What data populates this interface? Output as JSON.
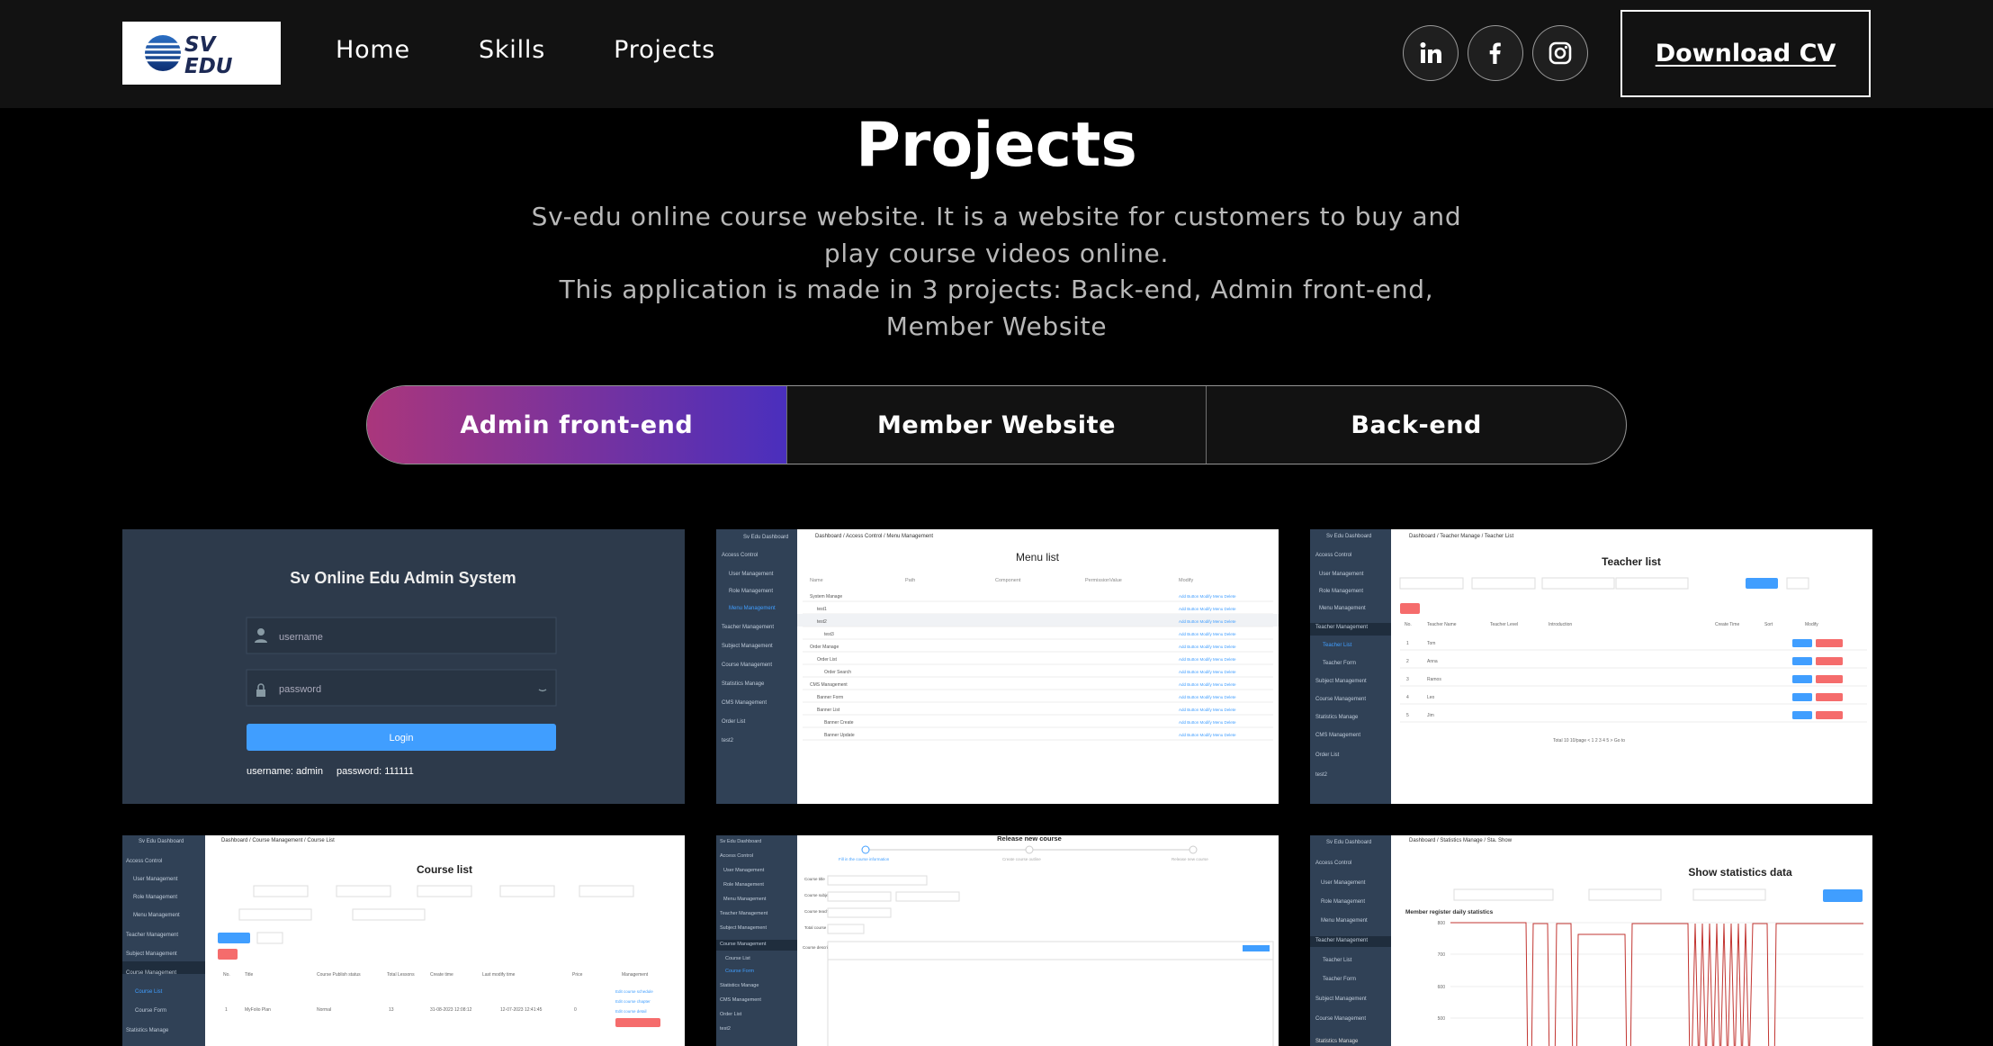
{
  "nav": {
    "logo_text": "SV EDU",
    "links": [
      "Home",
      "Skills",
      "Projects"
    ],
    "social_icons": [
      "linkedin-icon",
      "facebook-icon",
      "instagram-icon"
    ],
    "download_cv": "Download CV"
  },
  "projects": {
    "title": "Projects",
    "description_line1": "Sv-edu online course website. It is a website for customers to buy and play course videos online.",
    "description_line2": "This application is made in 3 projects: Back-end, Admin front-end, Member Website",
    "tabs": [
      "Admin front-end",
      "Member Website",
      "Back-end"
    ],
    "active_tab": "Admin front-end"
  },
  "gallery": {
    "login": {
      "title": "Sv Online Edu Admin System",
      "username_placeholder": "username",
      "password_placeholder": "password",
      "login_button": "Login",
      "hint_user": "username: admin",
      "hint_pass": "password: 111111"
    },
    "menu_list": {
      "title": "Menu list",
      "columns": [
        "Name",
        "Path",
        "Component",
        "PermissionValue",
        "Modify"
      ],
      "rows": [
        "System Manage",
        "test1",
        "test2",
        "test3",
        "Order Manage",
        "Order List",
        "Order Search",
        "CMS Management",
        "Banner Form",
        "Banner List",
        "Banner Create",
        "Banner Update"
      ]
    },
    "teacher_list": {
      "title": "Teacher list",
      "columns": [
        "No.",
        "Teacher Name",
        "Teacher Level",
        "Introduction",
        "Create Time",
        "Sort",
        "Modify"
      ],
      "rows": [
        "Tom",
        "Anna",
        "Ramos",
        "Leo",
        "Jim"
      ]
    },
    "course_list": {
      "title": "Course list",
      "columns": [
        "No.",
        "Title",
        "Course Publish status",
        "Total Lessons",
        "Create time",
        "Last modify time",
        "Price",
        "Management"
      ],
      "row_title": "MyFolio Plan",
      "row_status": "Normal"
    },
    "release_course": {
      "title": "Release new course",
      "steps": [
        "Fill in the course information",
        "Create course outline",
        "Release new course"
      ]
    },
    "statistics": {
      "title": "Show statistics data",
      "subtitle": "Member register daily statistics",
      "y_ticks": [
        "800",
        "700",
        "600",
        "500",
        "400"
      ]
    },
    "sidebar_items": [
      "Sv Edu Dashboard",
      "Access Control",
      "User Management",
      "Role Management",
      "Menu Management",
      "Teacher Management",
      "Subject Management",
      "Course Management",
      "Statistics Manage",
      "CMS Management",
      "Order List",
      "test2"
    ]
  },
  "colors": {
    "tab_gradient_start": "#aa367c",
    "tab_gradient_end": "#4a2fbd",
    "admin_sidebar": "#304156",
    "admin_primary": "#409eff"
  }
}
